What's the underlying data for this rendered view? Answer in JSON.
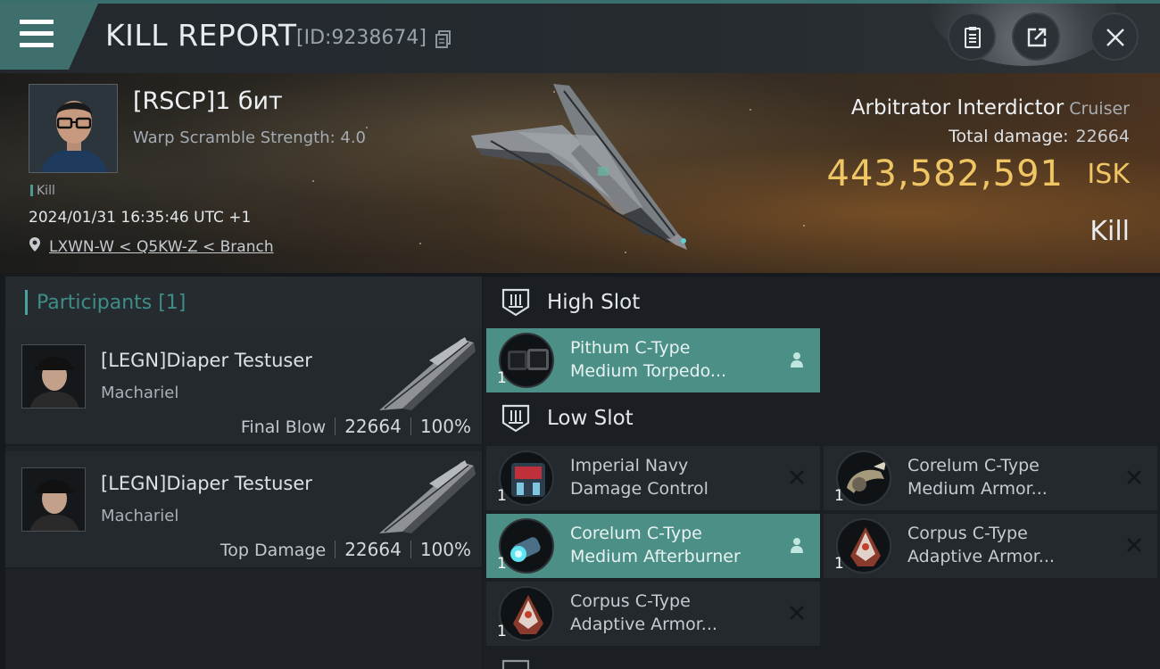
{
  "header": {
    "title": "KILL REPORT",
    "report_id": "[ID:9238674]",
    "icons": [
      "menu-icon",
      "copy-icon",
      "clipboard-icon",
      "share-icon",
      "close-icon"
    ]
  },
  "victim": {
    "name": "[RSCP]1 бит",
    "warp_scramble": "Warp Scramble Strength: 4.0",
    "tag": "Kill",
    "datetime": "2024/01/31 16:35:46 UTC +1",
    "location": "LXWN-W < Q5KW-Z < Branch",
    "ship_name": "Arbitrator Interdictor",
    "ship_class": "Cruiser",
    "total_damage_label": "Total damage:",
    "total_damage": "22664",
    "isk_value": "443,582,591",
    "isk_unit": "ISK",
    "result": "Kill"
  },
  "participants": {
    "title": "Participants [1]",
    "rows": [
      {
        "name": "[LEGN]Diaper Testuser",
        "ship": "Machariel",
        "role": "Final Blow",
        "damage": "22664",
        "percent": "100%"
      },
      {
        "name": "[LEGN]Diaper Testuser",
        "ship": "Machariel",
        "role": "Top Damage",
        "damage": "22664",
        "percent": "100%"
      }
    ]
  },
  "fitting": {
    "high_slot_title": "High Slot",
    "low_slot_title": "Low Slot",
    "high_modules": [
      {
        "qty": "1",
        "line1": "Pithum C-Type",
        "line2": "Medium Torpedo...",
        "status": "dropped",
        "highlight": true
      }
    ],
    "low_modules": [
      {
        "qty": "1",
        "line1": "Imperial Navy",
        "line2": "Damage Control",
        "status": "destroyed",
        "highlight": false
      },
      {
        "qty": "1",
        "line1": "Corelum C-Type",
        "line2": "Medium Armor...",
        "status": "destroyed",
        "highlight": false
      },
      {
        "qty": "1",
        "line1": "Corelum C-Type",
        "line2": "Medium Afterburner",
        "status": "dropped",
        "highlight": true
      },
      {
        "qty": "1",
        "line1": "Corpus C-Type",
        "line2": "Adaptive Armor...",
        "status": "destroyed",
        "highlight": false
      },
      {
        "qty": "1",
        "line1": "Corpus C-Type",
        "line2": "Adaptive Armor...",
        "status": "destroyed",
        "highlight": false
      }
    ]
  },
  "colors": {
    "accent_teal": "#4c8f86",
    "isk_gold": "#f0c665",
    "panel": "#24292e"
  }
}
